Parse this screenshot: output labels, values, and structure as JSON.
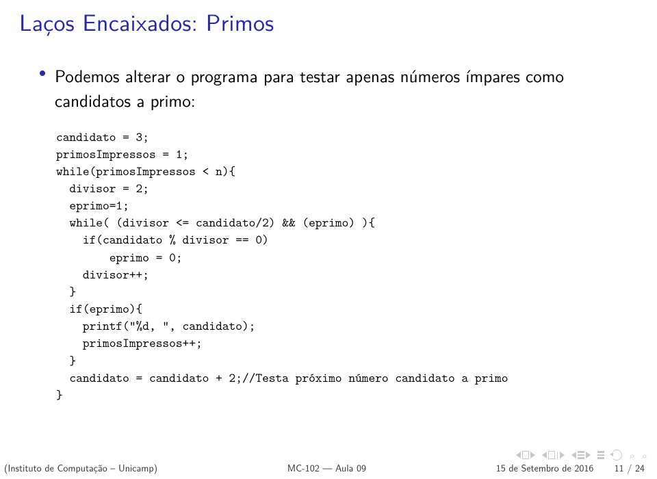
{
  "title": "Laços Encaixados: Primos",
  "bullet": "Podemos alterar o programa para testar apenas números ímpares como candidatos a primo:",
  "code": "candidato = 3;\nprimosImpressos = 1;\nwhile(primosImpressos < n){\n  divisor = 2;\n  eprimo=1;\n  while( (divisor <= candidato/2) && (eprimo) ){\n    if(candidato % divisor == 0)\n        eprimo = 0;\n    divisor++;\n  }\n  if(eprimo){\n    printf(\"%d, \", candidato);\n    primosImpressos++;\n  }\n  candidato = candidato + 2;//Testa próximo número candidato a primo\n}",
  "footer": {
    "left": "(Instituto de Computação – Unicamp)",
    "center": "MC-102 — Aula 09",
    "right": "15 de Setembro de 2016",
    "page": "11 / 24"
  }
}
